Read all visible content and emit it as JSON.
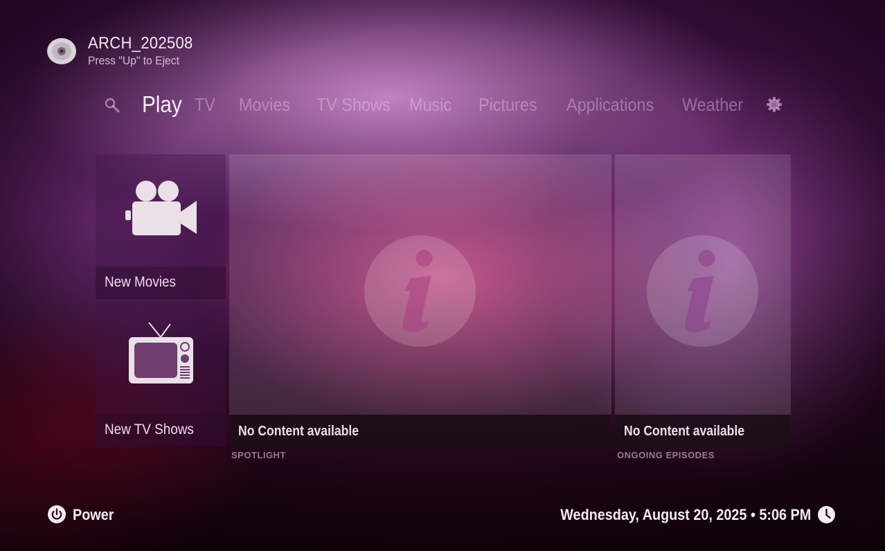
{
  "header": {
    "disc_title": "ARCH_202508",
    "disc_hint": "Press \"Up\" to Eject"
  },
  "nav": {
    "items": [
      {
        "label": "Play",
        "active": true
      },
      {
        "label": "TV"
      },
      {
        "label": "Movies"
      },
      {
        "label": "TV Shows"
      },
      {
        "label": "Music"
      },
      {
        "label": "Pictures"
      },
      {
        "label": "Applications"
      },
      {
        "label": "Weather"
      }
    ],
    "search_icon": "search-icon",
    "settings_icon": "gear-icon"
  },
  "tiles": {
    "new_movies": {
      "label": "New Movies",
      "icon": "movie-camera-icon"
    },
    "new_tv_shows": {
      "label": "New TV Shows",
      "icon": "television-icon"
    },
    "spotlight": {
      "label": "No Content available",
      "caption": "SPOTLIGHT",
      "icon": "info-icon"
    },
    "ongoing": {
      "label": "No Content available",
      "caption": "ONGOING EPISODES",
      "icon": "info-icon"
    }
  },
  "footer": {
    "power_label": "Power",
    "datetime": "Wednesday, August 20, 2025 • 5:06 PM"
  },
  "colors": {
    "accent": "#f4ecf2",
    "background_pink": "#e2508c",
    "background_purple": "#4a1550"
  }
}
